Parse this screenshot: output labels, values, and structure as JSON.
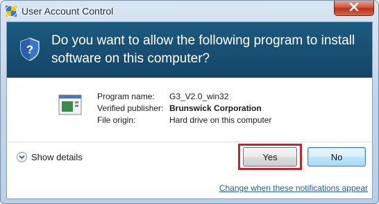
{
  "window": {
    "title": "User Account Control",
    "title_icon": "uac-shield-icon",
    "close_icon": "close-icon"
  },
  "banner": {
    "question": "Do you want to allow the following program to install software on this computer?",
    "icon": "shield-question-icon"
  },
  "program": {
    "icon": "installer-program-icon",
    "fields": [
      {
        "label": "Program name:",
        "value": "G3_V2.0_win32"
      },
      {
        "label": "Verified publisher:",
        "value": "Brunswick Corporation"
      },
      {
        "label": "File origin:",
        "value": "Hard drive on this computer"
      }
    ]
  },
  "footer": {
    "details_label": "Show details",
    "details_icon": "chevron-down-icon",
    "yes_label": "Yes",
    "no_label": "No",
    "link_text": "Change when these notifications appear"
  },
  "colors": {
    "banner": "#174d70",
    "highlight": "#c4222e",
    "link": "#1f5fa8"
  }
}
